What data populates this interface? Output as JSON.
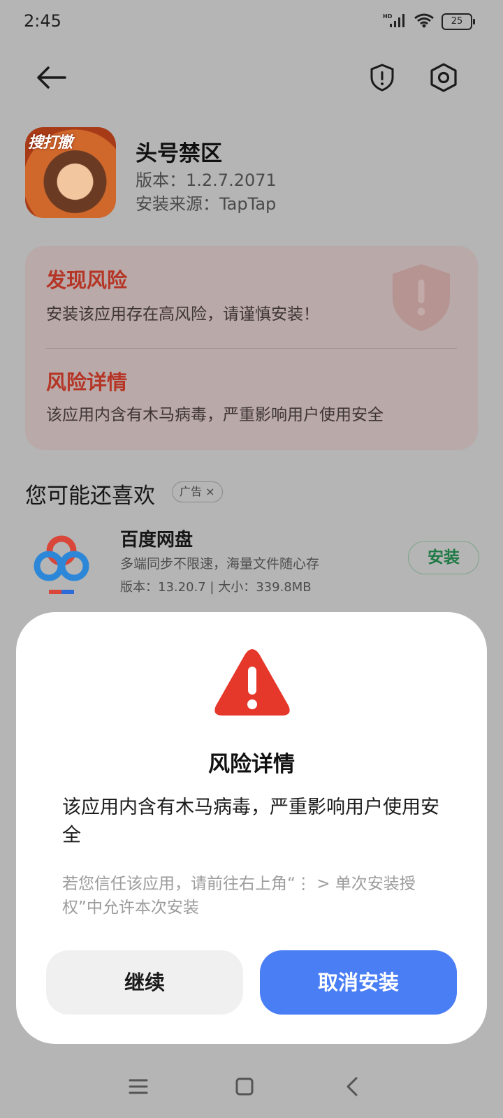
{
  "status_bar": {
    "time": "2:45",
    "network": "HD",
    "battery": "25"
  },
  "toolbar": {
    "back_icon": "arrow-left-icon",
    "security_icon": "shield-alert-icon",
    "settings_icon": "gear-icon"
  },
  "app": {
    "icon_text": "搜打撤",
    "name": "头号禁区",
    "version": "版本：1.2.7.2071",
    "source": "安装来源：TapTap"
  },
  "risk_card": {
    "title": "发现风险",
    "text": "安装该应用存在高风险，请谨慎安装！",
    "detail_title": "风险详情",
    "detail_text": "该应用内含有木马病毒，严重影响用户使用安全"
  },
  "recommend": {
    "title": "您可能还喜欢",
    "ad_label": "广告",
    "ad_close": "×",
    "app": {
      "name": "百度网盘",
      "desc": "多端同步不限速，海量文件随心存",
      "meta": "版本：13.20.7 | 大小：339.8MB",
      "install_label": "安装"
    }
  },
  "dialog": {
    "title": "风险详情",
    "message": "该应用内含有木马病毒，严重影响用户使用安全",
    "hint": "若您信任该应用，请前往右上角“⋮ > 单次安装授权”中允许本次安装",
    "continue_label": "继续",
    "cancel_label": "取消安装"
  },
  "colors": {
    "danger": "#b53526",
    "warning": "#e5372a",
    "primary": "#4a7ef5",
    "install_green": "#1f7a45"
  }
}
